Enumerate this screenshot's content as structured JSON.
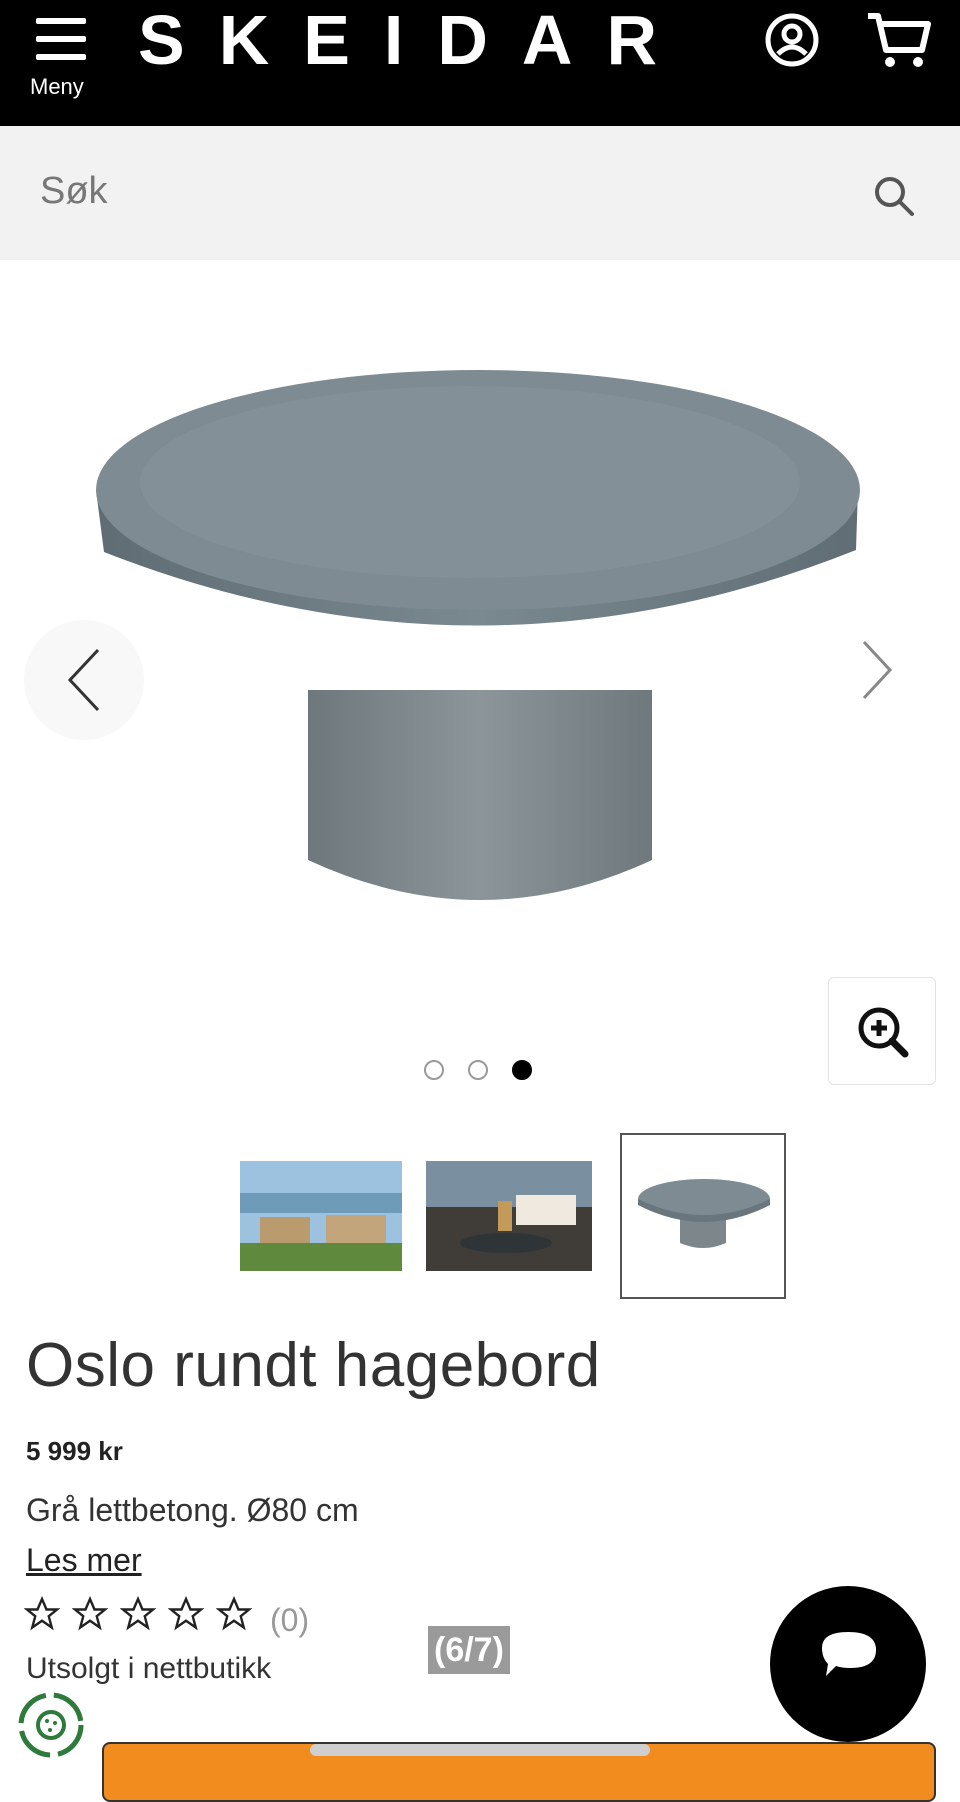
{
  "header": {
    "menu_label": "Meny",
    "brand": "SKEIDAR",
    "icons": [
      "hamburger-icon",
      "account-icon",
      "cart-icon"
    ]
  },
  "search": {
    "placeholder": "Søk",
    "icon": "search-icon"
  },
  "gallery": {
    "dots_total": 3,
    "dots_active": 3,
    "icons": [
      "chevron-left-icon",
      "chevron-right-icon",
      "zoom-in-icon"
    ],
    "thumbnails": [
      "outdoor-lounge-seaside",
      "patio-sofa-with-table",
      "round-concrete-table"
    ],
    "active_thumbnail": 3
  },
  "product": {
    "title": "Oslo rundt hagebord",
    "price": "5 999 kr",
    "description": "Grå lettbetong. Ø80 cm",
    "read_more": "Les mer",
    "rating_stars": 0,
    "rating_max": 5,
    "review_count": "(0)",
    "availability": "Utsolgt i nettbutikk"
  },
  "overlay": {
    "counter": "(6/7)"
  },
  "colors": {
    "header_bg": "#000000",
    "search_bg": "#f2f2f2",
    "cta": "#f28c1e",
    "table_gray": "#7d8a91"
  }
}
